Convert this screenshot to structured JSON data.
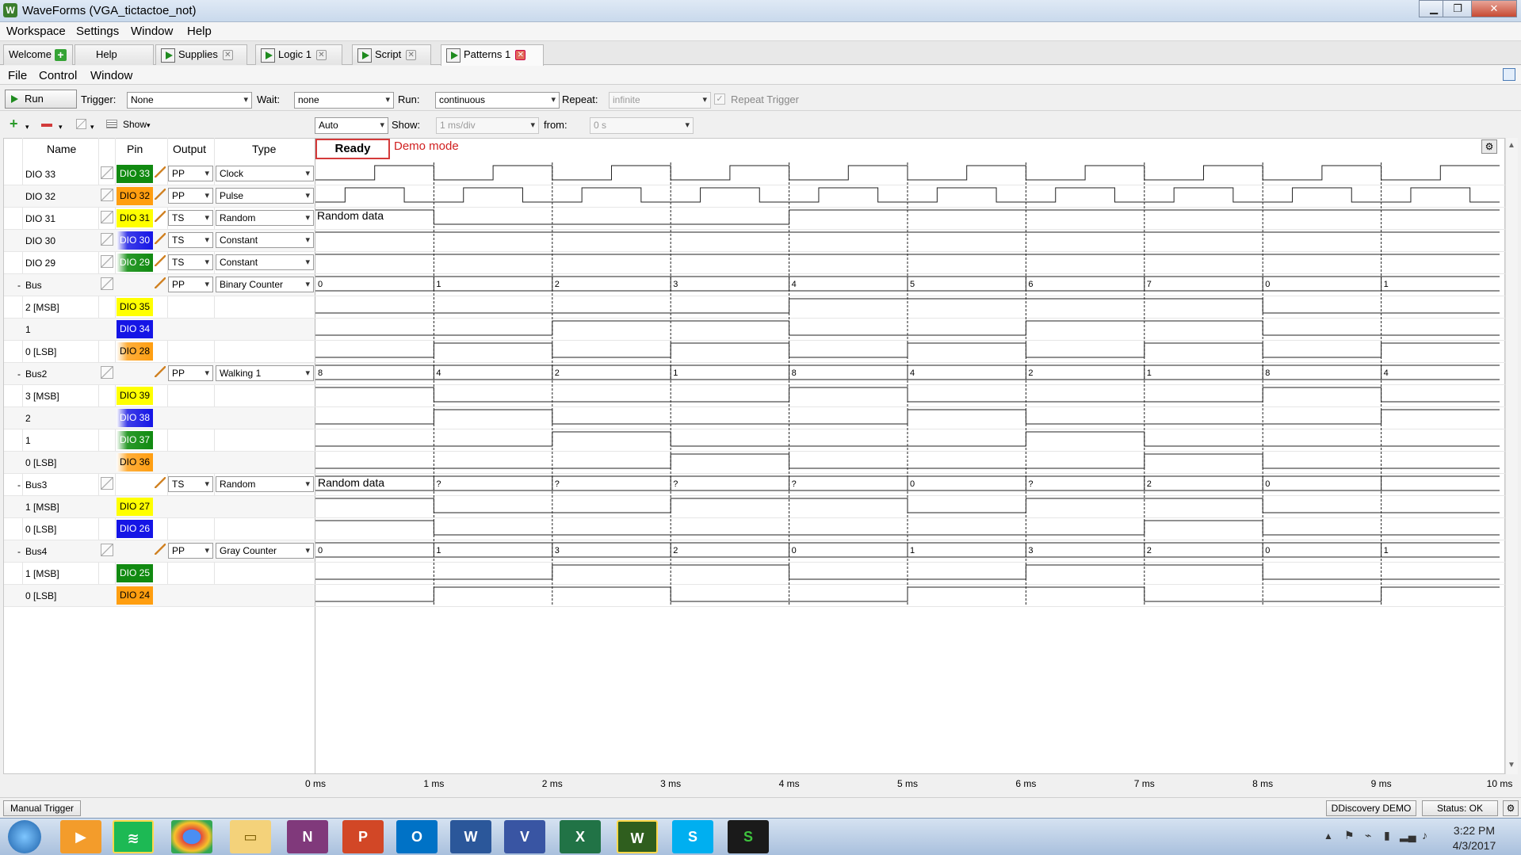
{
  "window": {
    "title": "WaveForms  (VGA_tictactoe_not)",
    "min": "▁",
    "max": "❐",
    "close": "✕"
  },
  "menubar": [
    "Workspace",
    "Settings",
    "Window",
    "Help"
  ],
  "tabs": [
    {
      "label": "Welcome"
    },
    {
      "label": "Help"
    },
    {
      "label": "Supplies"
    },
    {
      "label": "Logic 1"
    },
    {
      "label": "Script"
    },
    {
      "label": "Patterns 1"
    }
  ],
  "inner_menu": [
    "File",
    "Control",
    "Window"
  ],
  "toolbar1": {
    "run_label": "Run",
    "trigger_label": "Trigger:",
    "trigger_value": "None",
    "wait_label": "Wait:",
    "wait_value": "none",
    "run_mode_label": "Run:",
    "run_mode_value": "continuous",
    "repeat_label": "Repeat:",
    "repeat_value": "infinite",
    "repeat_trigger_label": "Repeat Trigger"
  },
  "toolbar2": {
    "show_label": "Show",
    "mode_value": "Auto",
    "show_div_label": "Show:",
    "show_div_value": "1 ms/div",
    "from_label": "from:",
    "from_value": "0 s"
  },
  "table": {
    "headers": {
      "name": "Name",
      "pin": "Pin",
      "output": "Output",
      "type": "Type"
    },
    "status": "Ready",
    "demo": "Demo mode",
    "rows": [
      {
        "name": "DIO 33",
        "pin": "DIO 33",
        "pin_color": "green",
        "output": "PP",
        "type": "Clock"
      },
      {
        "name": "DIO 32",
        "pin": "DIO 32",
        "pin_color": "orange",
        "output": "PP",
        "type": "Pulse"
      },
      {
        "name": "DIO 31",
        "pin": "DIO 31",
        "pin_color": "yellow",
        "output": "TS",
        "type": "Random"
      },
      {
        "name": "DIO 30",
        "pin": "DIO 30",
        "pin_color": "blue2",
        "output": "TS",
        "type": "Constant"
      },
      {
        "name": "DIO 29",
        "pin": "DIO 29",
        "pin_color": "green2",
        "output": "TS",
        "type": "Constant"
      },
      {
        "name": "Bus",
        "pin": "",
        "pin_color": "",
        "output": "PP",
        "type": "Binary Counter",
        "bus": true
      },
      {
        "name": "2 [MSB]",
        "pin": "DIO 35",
        "pin_color": "yellow"
      },
      {
        "name": "1",
        "pin": "DIO 34",
        "pin_color": "blue"
      },
      {
        "name": "0 [LSB]",
        "pin": "DIO 28",
        "pin_color": "orange2"
      },
      {
        "name": "Bus2",
        "pin": "",
        "pin_color": "",
        "output": "PP",
        "type": "Walking 1",
        "bus": true
      },
      {
        "name": "3 [MSB]",
        "pin": "DIO 39",
        "pin_color": "yellow"
      },
      {
        "name": "2",
        "pin": "DIO 38",
        "pin_color": "blue2"
      },
      {
        "name": "1",
        "pin": "DIO 37",
        "pin_color": "green2"
      },
      {
        "name": "0 [LSB]",
        "pin": "DIO 36",
        "pin_color": "orange2"
      },
      {
        "name": "Bus3",
        "pin": "",
        "pin_color": "",
        "output": "TS",
        "type": "Random",
        "bus": true
      },
      {
        "name": "1 [MSB]",
        "pin": "DIO 27",
        "pin_color": "yellow"
      },
      {
        "name": "0 [LSB]",
        "pin": "DIO 26",
        "pin_color": "blue"
      },
      {
        "name": "Bus4",
        "pin": "",
        "pin_color": "",
        "output": "PP",
        "type": "Gray Counter",
        "bus": true
      },
      {
        "name": "1 [MSB]",
        "pin": "DIO 25",
        "pin_color": "green"
      },
      {
        "name": "0 [LSB]",
        "pin": "DIO 24",
        "pin_color": "orange"
      }
    ]
  },
  "waveforms": {
    "divisions": 10,
    "axis_labels": [
      "0 ms",
      "1 ms",
      "2 ms",
      "3 ms",
      "4 ms",
      "5 ms",
      "6 ms",
      "7 ms",
      "8 ms",
      "9 ms",
      "10 ms"
    ],
    "random_label": "Random data",
    "bus_values": [
      [
        "0",
        "1",
        "2",
        "3",
        "4",
        "5",
        "6",
        "7",
        "0",
        "1"
      ],
      [
        "8",
        "4",
        "2",
        "1",
        "8",
        "4",
        "2",
        "1",
        "8",
        "4"
      ],
      [
        "Random data",
        "?",
        "?",
        "?",
        "?",
        "0",
        "?",
        "2",
        "0",
        ""
      ],
      [
        "0",
        "1",
        "3",
        "2",
        "0",
        "1",
        "3",
        "2",
        "0",
        "1"
      ]
    ]
  },
  "statusbar": {
    "manual_trigger": "Manual Trigger",
    "device": "DDiscovery DEMO",
    "status": "Status: OK"
  },
  "taskbar": {
    "apps": [
      "start",
      "media",
      "spotify",
      "chrome",
      "explorer",
      "onenote",
      "powerpoint",
      "outlook",
      "word",
      "visio",
      "excel",
      "waveforms",
      "skype",
      "other"
    ],
    "time": "3:22 PM",
    "date": "4/3/2017"
  }
}
